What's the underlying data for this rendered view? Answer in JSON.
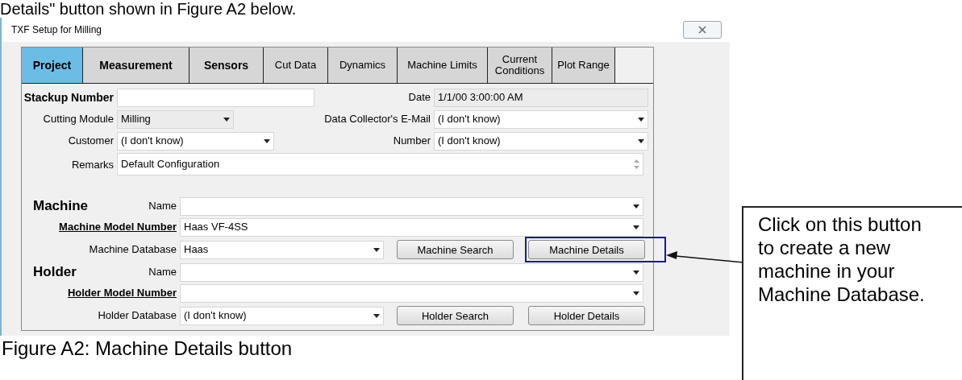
{
  "intro_text": "Details\" button shown in Figure A2 below.",
  "window": {
    "title": "TXF Setup for Milling"
  },
  "tabs": [
    {
      "label": "Project",
      "selected": true,
      "bold": true
    },
    {
      "label": "Measurement",
      "selected": false,
      "bold": true
    },
    {
      "label": "Sensors",
      "selected": false,
      "bold": true
    },
    {
      "label": "Cut Data",
      "selected": false,
      "bold": false
    },
    {
      "label": "Dynamics",
      "selected": false,
      "bold": false
    },
    {
      "label": "Machine Limits",
      "selected": false,
      "bold": false
    },
    {
      "label": "Current Conditions",
      "selected": false,
      "bold": false
    },
    {
      "label": "Plot Range",
      "selected": false,
      "bold": false
    }
  ],
  "project_rows": [
    {
      "left": {
        "label": "Stackup Number",
        "bold": true,
        "kind": "text"
      },
      "right": {
        "label": "Date",
        "kind": "readonly",
        "value": "1/1/00 3:00:00 AM"
      }
    },
    {
      "left": {
        "label": "Cutting Module",
        "bold": false,
        "kind": "dropdown",
        "value": "Milling",
        "disabled": true
      },
      "right": {
        "label": "Data Collector's E-Mail",
        "kind": "dropdown",
        "value": "(I don't know)"
      }
    },
    {
      "left": {
        "label": "Customer",
        "bold": false,
        "kind": "dropdown",
        "value": "(I don't know)",
        "disabled": false
      },
      "right": {
        "label": "Number",
        "kind": "dropdown",
        "value": "(I don't know)"
      }
    }
  ],
  "remarks": {
    "label": "Remarks",
    "value": "Default Configuration"
  },
  "sections": [
    {
      "heading": "Machine",
      "name_label": "Name",
      "model_label": "Machine Model Number",
      "model_value": "Haas VF-4SS",
      "database_label": "Machine Database",
      "database_value": "Haas",
      "buttons": [
        {
          "label": "Machine Search",
          "highlighted": false
        },
        {
          "label": "Machine Details",
          "highlighted": true
        }
      ]
    },
    {
      "heading": "Holder",
      "name_label": "Name",
      "model_label": "Holder Model Number",
      "database_label": "Holder Database",
      "database_value": "(I don't know)",
      "buttons": [
        {
          "label": "Holder Search",
          "highlighted": false
        },
        {
          "label": "Holder Details",
          "highlighted": false
        }
      ]
    }
  ],
  "callout": "Click on this button to create a new machine in your Machine Database.",
  "caption": "Figure A2: Machine Details button"
}
